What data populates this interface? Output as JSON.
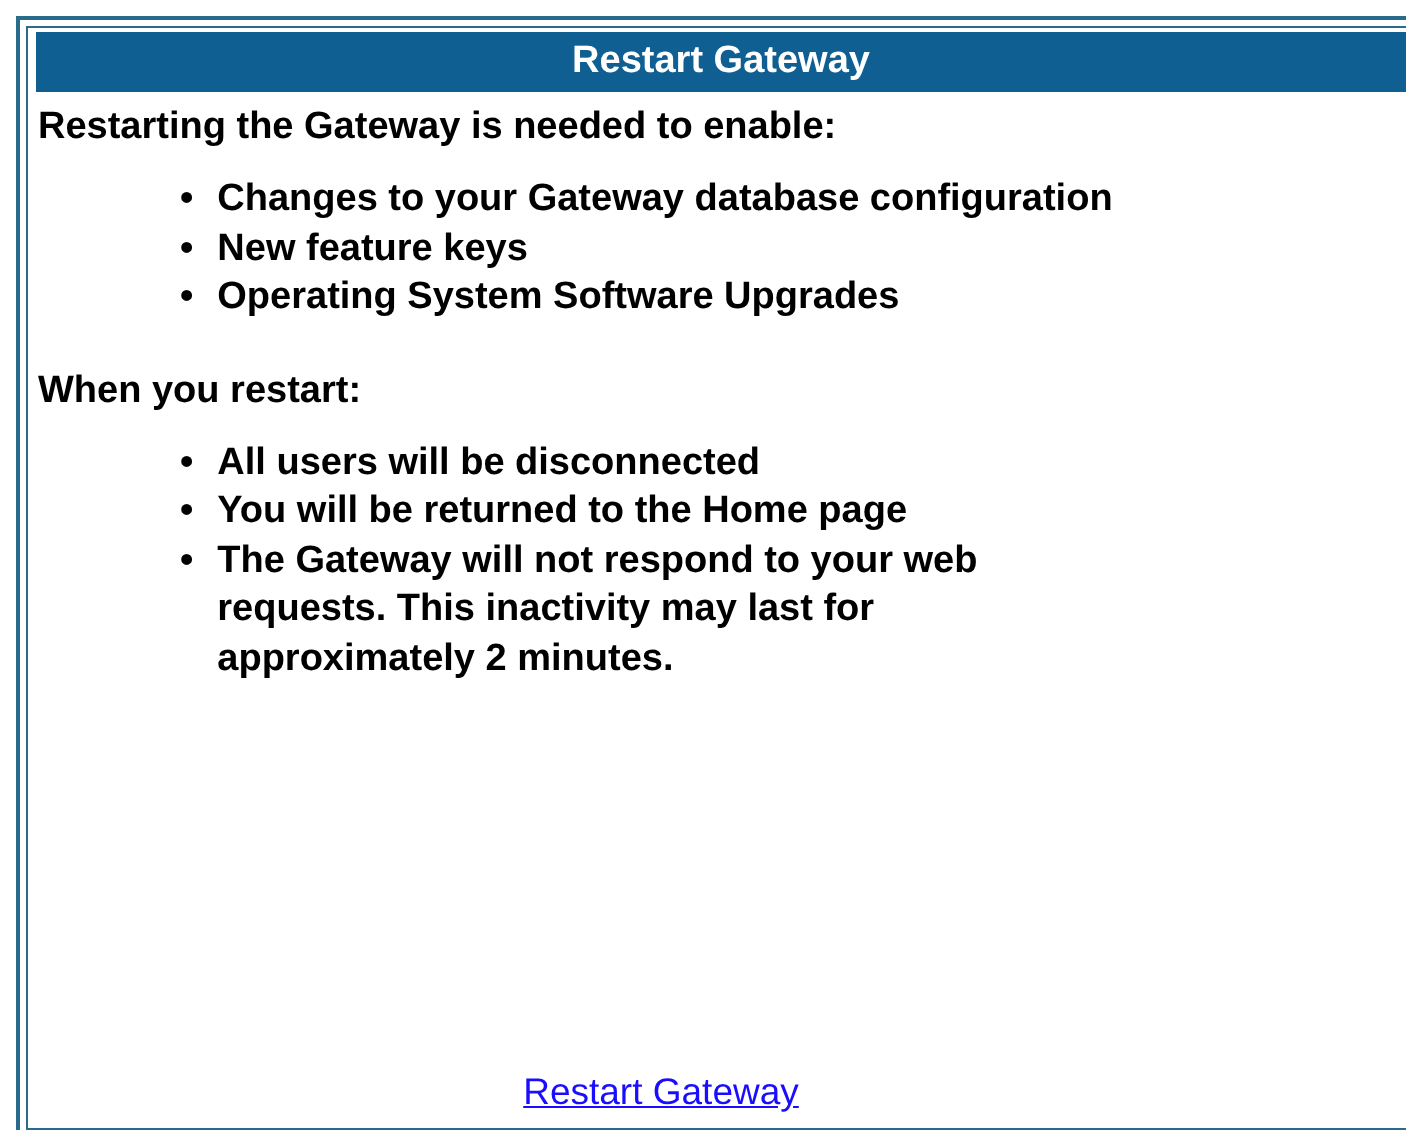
{
  "header": {
    "title": "Restart Gateway"
  },
  "sections": [
    {
      "heading": "Restarting the Gateway is needed to enable:",
      "items": [
        {
          "bullet": "•",
          "text": "Changes to your Gateway database configuration"
        },
        {
          "bullet": "•",
          "text": "New feature keys"
        },
        {
          "bullet": "•",
          "text": "Operating System Software Upgrades"
        }
      ]
    },
    {
      "heading": "When you restart:",
      "items": [
        {
          "bullet": "•",
          "text": "All users will be disconnected"
        },
        {
          "bullet": "•",
          "text": "You will be returned to the Home page"
        },
        {
          "bullet": "•",
          "text": "The Gateway will not respond to your web requests. This inactivity may last for approximately 2 minutes."
        }
      ]
    }
  ],
  "link": "Restart Gateway"
}
